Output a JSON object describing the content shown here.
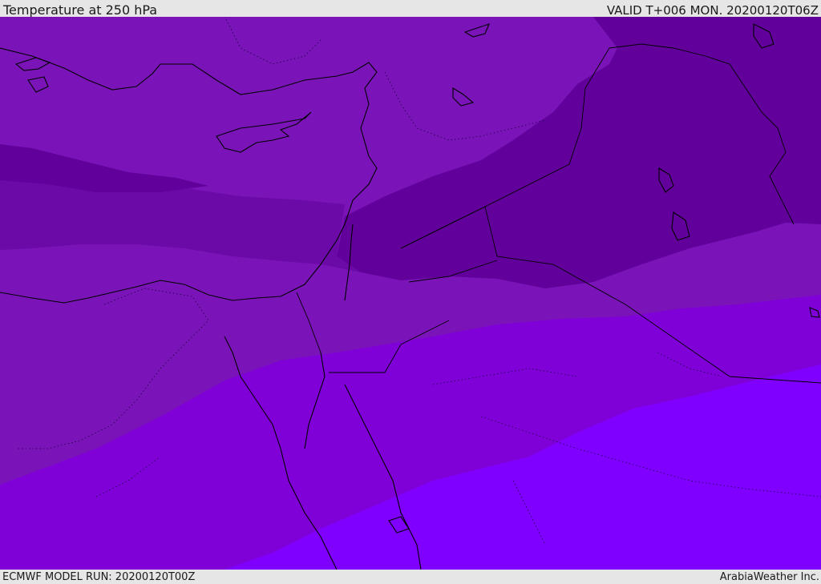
{
  "header": {
    "title": "Temperature at 250 hPa",
    "valid": "VALID T+006 MON. 20200120T06Z"
  },
  "footer": {
    "model_run": "ECMWF MODEL RUN: 20200120T00Z",
    "credit": "ArabiaWeather Inc."
  },
  "map": {
    "fill_colors": {
      "darkest": "#62009b",
      "dark": "#6c0aa8",
      "mid": "#7a14b8",
      "light": "#8000d8",
      "lightest": "#7f00ff",
      "coast": "#000000"
    }
  }
}
